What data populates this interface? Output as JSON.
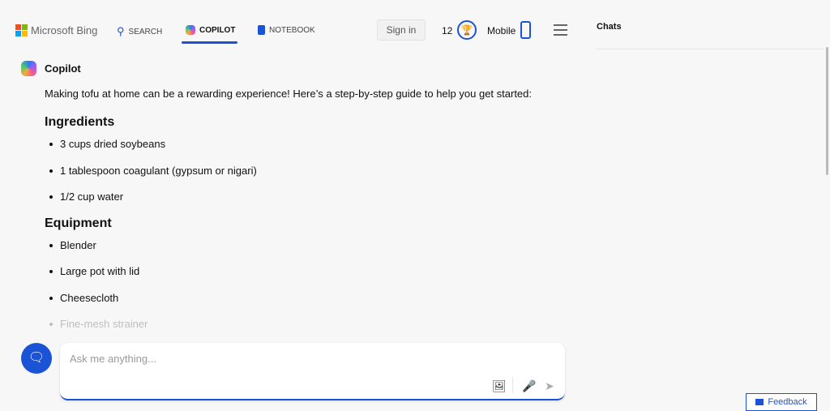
{
  "header": {
    "brand": "Microsoft Bing",
    "tabs": [
      {
        "label": "SEARCH"
      },
      {
        "label": "COPILOT",
        "active": true
      },
      {
        "label": "NOTEBOOK"
      }
    ],
    "sign_in": "Sign in",
    "points": "12",
    "mobile": "Mobile"
  },
  "sidebar": {
    "title": "Chats"
  },
  "message": {
    "author": "Copilot",
    "intro": "Making tofu at home can be a rewarding experience! Here’s a step-by-step guide to help you get started:",
    "sections": [
      {
        "heading": "Ingredients",
        "items": [
          "3 cups dried soybeans",
          "1 tablespoon coagulant (gypsum or nigari)",
          "1/2 cup water"
        ]
      },
      {
        "heading": "Equipment",
        "items": [
          "Blender",
          "Large pot with lid",
          "Cheesecloth",
          "Fine-mesh strainer"
        ]
      }
    ]
  },
  "composer": {
    "placeholder": "Ask me anything..."
  },
  "feedback": "Feedback",
  "colors": {
    "accent": "#1a53d6"
  }
}
